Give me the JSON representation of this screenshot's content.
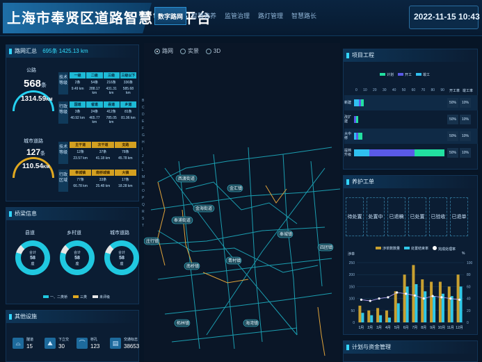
{
  "header": {
    "title": "上海市奉贤区道路智慧管养平台",
    "date": "2022-11-15 10:43",
    "tabs": [
      {
        "label": "数字路网",
        "active": true
      },
      {
        "label": "智慧管养"
      },
      {
        "label": "监管治理"
      },
      {
        "label": "路灯管理"
      },
      {
        "label": "智慧路长"
      }
    ]
  },
  "road_summary": {
    "title": "路网汇总",
    "count_text": "695条 1425.13 km",
    "highway": {
      "label": "公路",
      "count": "568",
      "unit": "条",
      "km": "1314.59",
      "km_unit": "KM",
      "tech_label": "技术等级",
      "tech_heads": [
        "一级",
        "二级",
        "三级",
        "三级以下"
      ],
      "tech_counts": [
        "2条",
        "54条",
        "216条",
        "336条"
      ],
      "tech_km": [
        "9.49 km",
        "288.17 km",
        "431.31 km",
        "585.68 km"
      ],
      "admin_label": "行政等级",
      "admin_heads": [
        "国道",
        "省道",
        "县道",
        "乡道"
      ],
      "admin_counts": [
        "3条",
        "24条",
        "412条",
        "81条"
      ],
      "admin_km": [
        "40.92 km",
        "465.77 km",
        "785.05 km",
        "81.96 km"
      ]
    },
    "city": {
      "label": "城市道路",
      "count": "127",
      "unit": "条",
      "km": "110.54",
      "km_unit": "KM",
      "tech_label": "技术等级",
      "tech_heads": [
        "主干道",
        "次干道",
        "支路"
      ],
      "tech_counts": [
        "12条",
        "37条",
        "78条"
      ],
      "tech_km": [
        "23.57 km",
        "41.18 km",
        "45.78 km"
      ],
      "admin_label": "行政区域",
      "admin_heads": [
        "奉城镇",
        "南桥城镇",
        "大镇"
      ],
      "admin_counts": [
        "77条",
        "33条",
        "17条"
      ],
      "admin_km": [
        "66.78 km",
        "25.48 km",
        "18.28 km"
      ]
    }
  },
  "bridges": {
    "title": "桥梁信息",
    "groups": [
      {
        "label": "县道",
        "sum": "合计",
        "value": "58",
        "unit": "座"
      },
      {
        "label": "乡村道",
        "sum": "合计",
        "value": "58",
        "unit": "座"
      },
      {
        "label": "城市道路",
        "sum": "合计",
        "value": "58",
        "unit": "座"
      }
    ],
    "legend": [
      "一、二类桥",
      "三类",
      "未评级"
    ]
  },
  "facilities": {
    "title": "其他设施",
    "items": [
      {
        "label": "隧道",
        "value": "15"
      },
      {
        "label": "下立交",
        "value": "30"
      },
      {
        "label": "桥孔",
        "value": "123"
      },
      {
        "label": "交通标志",
        "value": "38653"
      }
    ]
  },
  "map": {
    "modes": [
      {
        "label": "路网",
        "on": true
      },
      {
        "label": "实景",
        "on": false
      },
      {
        "label": "3D",
        "on": false
      }
    ],
    "places": [
      "西渡街道",
      "金汇镇",
      "金海街道",
      "青村镇",
      "柘林镇",
      "海湾镇",
      "庄行镇",
      "奉城镇",
      "四团镇",
      "南桥镇",
      "奉浦街道"
    ],
    "left_letters": [
      "B",
      "C",
      "D",
      "E",
      "F",
      "G",
      "H",
      "I",
      "J",
      "K",
      "L",
      "M",
      "N",
      "O",
      "P",
      "Q",
      "R",
      "S",
      "T"
    ]
  },
  "projects": {
    "title": "项目工程",
    "legend": [
      "计划",
      "开工",
      "竣工"
    ],
    "col_heads": [
      "开工率",
      "竣工率"
    ],
    "ticks": [
      "0",
      "10",
      "20",
      "30",
      "40",
      "50",
      "60",
      "70",
      "80",
      "90"
    ],
    "rows": [
      {
        "label": "新建",
        "open": "50%",
        "done": "10%"
      },
      {
        "label": "改扩建",
        "open": "50%",
        "done": "10%"
      },
      {
        "label": "大中修",
        "open": "50%",
        "done": "10%"
      },
      {
        "label": "提档升级",
        "open": "50%",
        "done": "10%"
      }
    ]
  },
  "orders": {
    "title": "养护工单",
    "statuses": [
      "待处置",
      "处置中",
      "已退稿",
      "已处置",
      "已验收",
      "已退单"
    ],
    "legend": [
      "涉单数数量",
      "处置结束率",
      "完成处理率"
    ],
    "y_label_left": "涉单",
    "y_label_right": "%",
    "months": [
      "1月",
      "2月",
      "3月",
      "4月",
      "5月",
      "6月",
      "7月",
      "8月",
      "9月",
      "10月",
      "11月",
      "12月"
    ],
    "y_ticks": [
      "0",
      "50",
      "100",
      "150",
      "200",
      "250"
    ],
    "y2_ticks": [
      "0",
      "20",
      "40",
      "60",
      "80",
      "100"
    ]
  },
  "plan": {
    "title": "计划与资金管理"
  },
  "chart_data": {
    "type": "bar",
    "categories": [
      "1月",
      "2月",
      "3月",
      "4月",
      "5月",
      "6月",
      "7月",
      "8月",
      "9月",
      "10月",
      "11月",
      "12月"
    ],
    "series": [
      {
        "name": "涉单数数量",
        "values": [
          70,
          50,
          60,
          50,
          130,
          200,
          240,
          180,
          170,
          170,
          150,
          200
        ]
      },
      {
        "name": "处置结束率",
        "values": [
          40,
          30,
          30,
          20,
          80,
          150,
          160,
          130,
          110,
          120,
          110,
          150
        ]
      },
      {
        "name": "完成处理率",
        "values": [
          38,
          36,
          40,
          42,
          50,
          48,
          45,
          40,
          44,
          42,
          40,
          38
        ]
      }
    ],
    "ylim": [
      0,
      250
    ]
  },
  "project_chart": {
    "type": "bar",
    "values": [
      {
        "plan": 6,
        "open": 2,
        "done": 5
      },
      {
        "plan": 4,
        "open": 2,
        "done": 0
      },
      {
        "plan": 8,
        "open": 2,
        "done": 2
      },
      {
        "plan": 60,
        "open": 45,
        "done": 15
      }
    ]
  }
}
